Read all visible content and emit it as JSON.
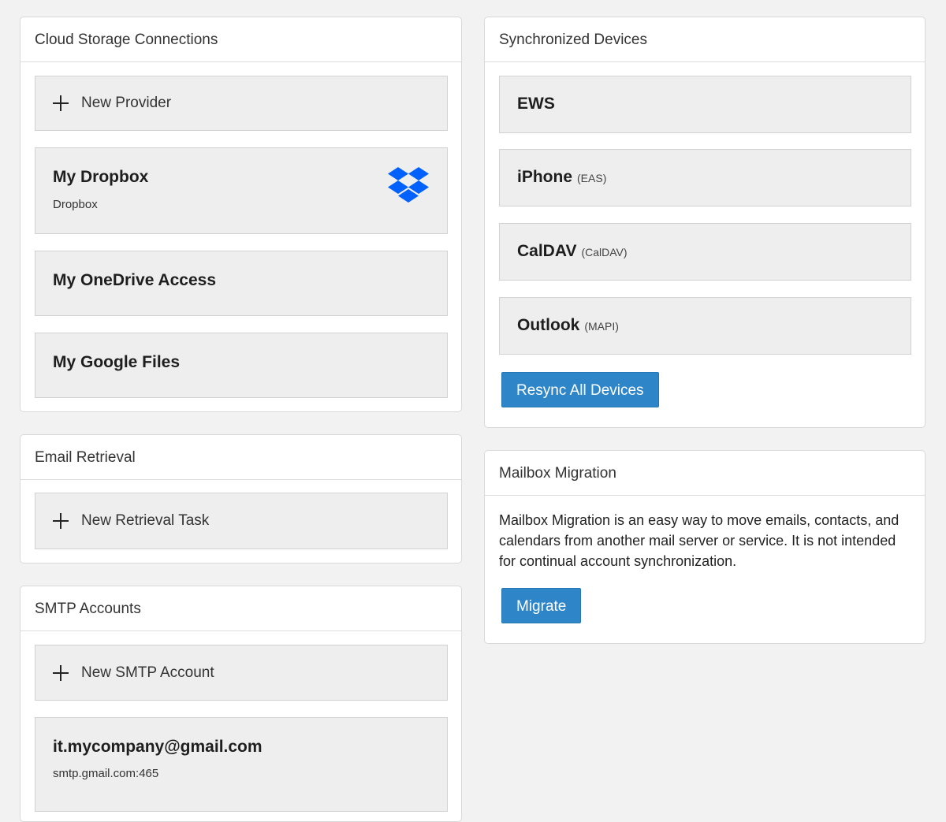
{
  "cloud_storage": {
    "title": "Cloud Storage Connections",
    "new_label": "New Provider",
    "providers": [
      {
        "name": "My Dropbox",
        "type": "Dropbox",
        "icon": "dropbox-icon"
      },
      {
        "name": "My OneDrive Access"
      },
      {
        "name": "My Google Files"
      }
    ]
  },
  "email_retrieval": {
    "title": "Email Retrieval",
    "new_label": "New Retrieval Task"
  },
  "smtp": {
    "title": "SMTP Accounts",
    "new_label": "New SMTP Account",
    "accounts": [
      {
        "name": "it.mycompany@gmail.com",
        "server": "smtp.gmail.com:465"
      }
    ]
  },
  "devices": {
    "title": "Synchronized Devices",
    "items": [
      {
        "name": "EWS",
        "protocol": ""
      },
      {
        "name": "iPhone",
        "protocol": "(EAS)"
      },
      {
        "name": "CalDAV",
        "protocol": "(CalDAV)"
      },
      {
        "name": "Outlook",
        "protocol": "(MAPI)"
      }
    ],
    "resync_label": "Resync All Devices"
  },
  "migration": {
    "title": "Mailbox Migration",
    "description": "Mailbox Migration is an easy way to move emails, contacts, and calendars from another mail server or service. It is not intended for continual account synchronization.",
    "migrate_label": "Migrate"
  },
  "colors": {
    "accent": "#2e86c8",
    "dropbox_blue": "#0061fe",
    "tile_bg": "#eeeeee",
    "page_bg": "#f2f2f2"
  }
}
